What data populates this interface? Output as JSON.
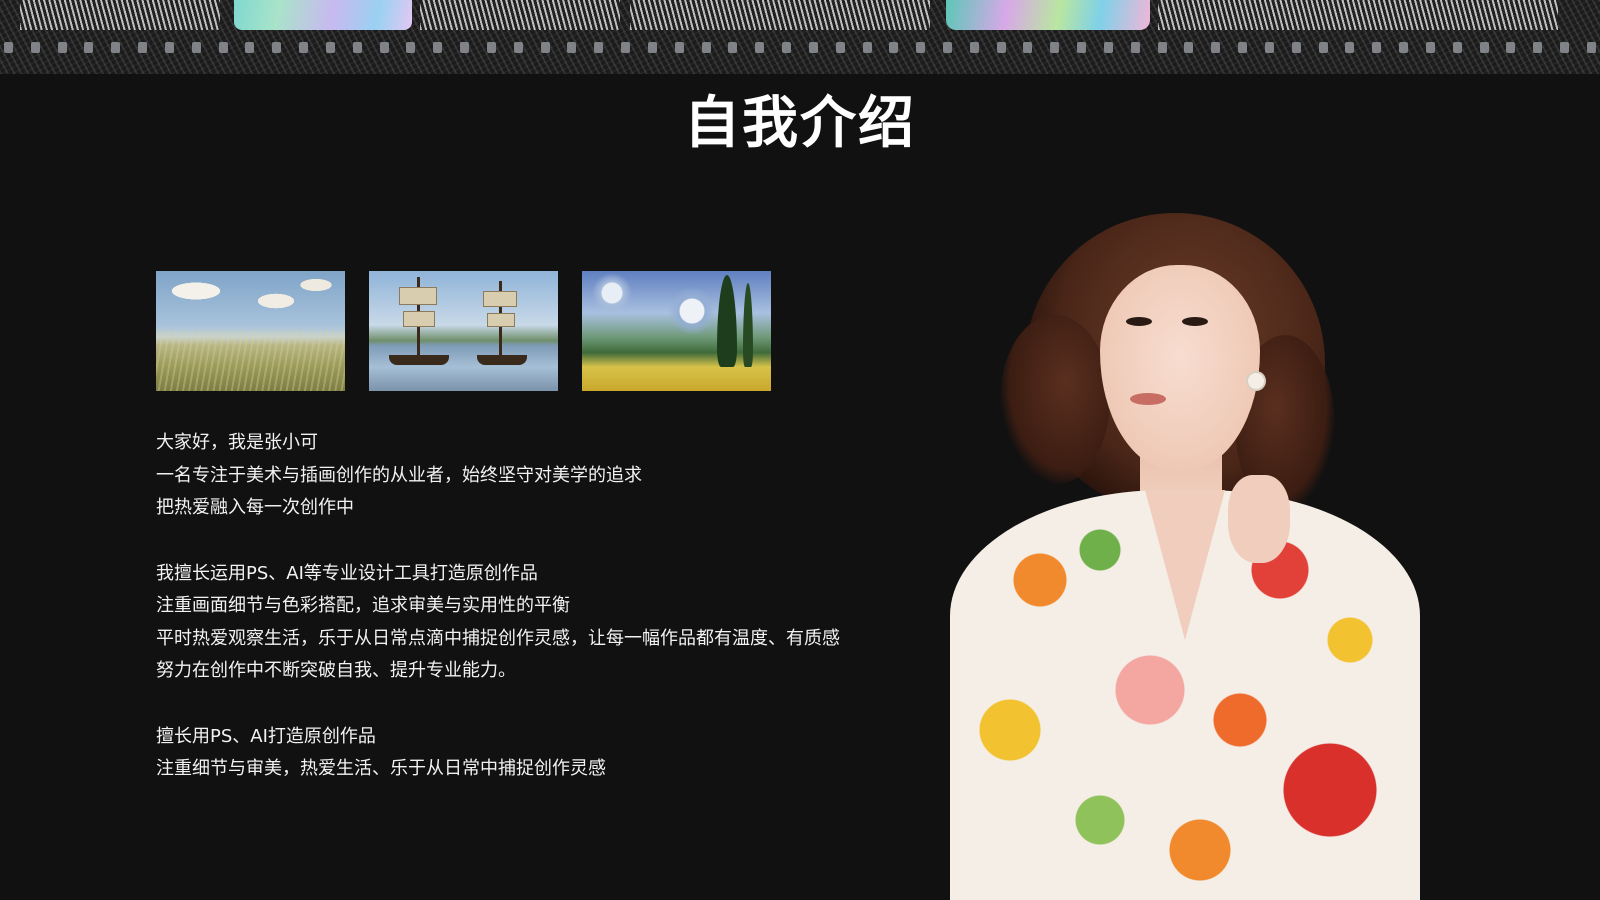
{
  "title": "自我介绍",
  "thumbnails": [
    {
      "name": "painting-meadow",
      "alt": ""
    },
    {
      "name": "painting-ships",
      "alt": ""
    },
    {
      "name": "painting-wheatfield",
      "alt": ""
    }
  ],
  "bio": {
    "para1": [
      "大家好，我是张小可",
      "一名专注于美术与插画创作的从业者，始终坚守对美学的追求",
      "把热爱融入每一次创作中"
    ],
    "para2": [
      "我擅长运用PS、AI等专业设计工具打造原创作品",
      "注重画面细节与色彩搭配，追求审美与实用性的平衡",
      "平时热爱观察生活，乐于从日常点滴中捕捉创作灵感，让每一幅作品都有温度、有质感",
      "努力在创作中不断突破自我、提升专业能力。"
    ],
    "para3": [
      "擅长用PS、AI打造原创作品",
      "注重细节与审美，热爱生活、乐于从日常中捕捉创作灵感"
    ]
  },
  "colors": {
    "background": "#111111",
    "text": "#f2f2f2",
    "title": "#ffffff"
  }
}
